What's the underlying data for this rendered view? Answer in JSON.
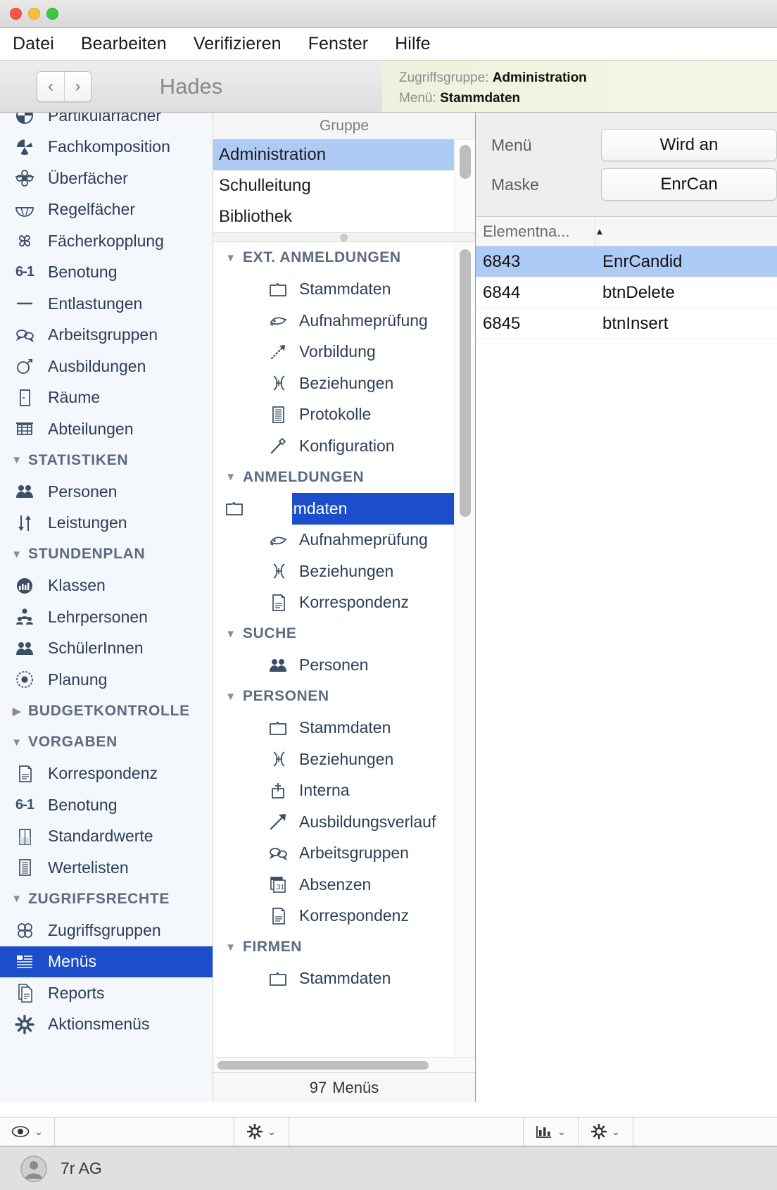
{
  "window": {
    "traffic_lights": [
      "close",
      "minimize",
      "zoom"
    ],
    "app_title": "Hades"
  },
  "menubar": {
    "items": [
      {
        "label": "Datei"
      },
      {
        "label": "Bearbeiten"
      },
      {
        "label": "Verifizieren"
      },
      {
        "label": "Fenster"
      },
      {
        "label": "Hilfe"
      }
    ]
  },
  "toolbar": {
    "back_icon": "‹",
    "forward_icon": "›",
    "title": "Hades",
    "info": {
      "line1_label": "Zugriffsgruppe:",
      "line1_value": "Administration",
      "line2_label": "Menü:",
      "line2_value": "Stammdaten"
    }
  },
  "sidebar": {
    "items": [
      {
        "label": "Partikularfächer",
        "icon": "pie-half-icon",
        "type": "item",
        "clipped": true
      },
      {
        "label": "Fachkomposition",
        "icon": "pie-icon",
        "type": "item"
      },
      {
        "label": "Überfächer",
        "icon": "flower-icon",
        "type": "item"
      },
      {
        "label": "Regelfächer",
        "icon": "halfcircle-icon",
        "type": "item"
      },
      {
        "label": "Fächerkopplung",
        "icon": "pinwheel-icon",
        "type": "item"
      },
      {
        "label": "Benotung",
        "icon": "grade-6-1-icon",
        "type": "item"
      },
      {
        "label": "Entlastungen",
        "icon": "dash-icon",
        "type": "item"
      },
      {
        "label": "Arbeitsgruppen",
        "icon": "speech-bubbles-icon",
        "type": "item"
      },
      {
        "label": "Ausbildungen",
        "icon": "circle-arrow-icon",
        "type": "item"
      },
      {
        "label": "Räume",
        "icon": "door-icon",
        "type": "item"
      },
      {
        "label": "Abteilungen",
        "icon": "building-icon",
        "type": "item"
      },
      {
        "label": "STATISTIKEN",
        "icon": "triangle-down-icon",
        "type": "group",
        "expanded": true
      },
      {
        "label": "Personen",
        "icon": "people-icon",
        "type": "item"
      },
      {
        "label": "Leistungen",
        "icon": "updown-arrows-icon",
        "type": "item"
      },
      {
        "label": "STUNDENPLAN",
        "icon": "triangle-down-icon",
        "type": "group",
        "expanded": true
      },
      {
        "label": "Klassen",
        "icon": "class-circle-icon",
        "type": "item"
      },
      {
        "label": "Lehrpersonen",
        "icon": "teacher-icon",
        "type": "item"
      },
      {
        "label": "SchülerInnen",
        "icon": "people-icon",
        "type": "item"
      },
      {
        "label": "Planung",
        "icon": "target-icon",
        "type": "item"
      },
      {
        "label": "BUDGETKONTROLLE",
        "icon": "triangle-right-icon",
        "type": "group",
        "expanded": false
      },
      {
        "label": "VORGABEN",
        "icon": "triangle-down-icon",
        "type": "group",
        "expanded": true
      },
      {
        "label": "Korrespondenz",
        "icon": "document-icon",
        "type": "item"
      },
      {
        "label": "Benotung",
        "icon": "grade-6-1-icon",
        "type": "item"
      },
      {
        "label": "Standardwerte",
        "icon": "halffilled-doc-icon",
        "type": "item"
      },
      {
        "label": "Wertelisten",
        "icon": "list-lines-icon",
        "type": "item"
      },
      {
        "label": "ZUGRIFFSRECHTE",
        "icon": "triangle-down-icon",
        "type": "group",
        "expanded": true
      },
      {
        "label": "Zugriffsgruppen",
        "icon": "four-circles-icon",
        "type": "item"
      },
      {
        "label": "Menüs",
        "icon": "menu-list-icon",
        "type": "item",
        "selected": true
      },
      {
        "label": "Reports",
        "icon": "report-doc-icon",
        "type": "item"
      },
      {
        "label": "Aktionsmenüs",
        "icon": "gear-icon",
        "type": "item"
      }
    ],
    "selected": "Menüs"
  },
  "middle": {
    "group_column_header": "Gruppe",
    "groups": [
      {
        "label": "Administration",
        "selected": true
      },
      {
        "label": "Schulleitung",
        "selected": false
      },
      {
        "label": "Bibliothek",
        "selected": false
      }
    ],
    "tree": [
      {
        "label": "EXT. ANMELDUNGEN",
        "type": "group",
        "icon": "triangle-down-icon"
      },
      {
        "label": "Stammdaten",
        "type": "item",
        "icon": "folder-icon"
      },
      {
        "label": "Aufnahmeprüfung",
        "type": "item",
        "icon": "exam-icon"
      },
      {
        "label": "Vorbildung",
        "type": "item",
        "icon": "dotted-arrow-icon"
      },
      {
        "label": "Beziehungen",
        "type": "item",
        "icon": "relations-icon"
      },
      {
        "label": "Protokolle",
        "type": "item",
        "icon": "list-lines-icon"
      },
      {
        "label": "Konfiguration",
        "type": "item",
        "icon": "screwdriver-icon"
      },
      {
        "label": "ANMELDUNGEN",
        "type": "group",
        "icon": "triangle-down-icon"
      },
      {
        "label": "Stammdaten",
        "type": "item",
        "icon": "folder-icon",
        "selected": true
      },
      {
        "label": "Aufnahmeprüfung",
        "type": "item",
        "icon": "exam-icon"
      },
      {
        "label": "Beziehungen",
        "type": "item",
        "icon": "relations-icon"
      },
      {
        "label": "Korrespondenz",
        "type": "item",
        "icon": "document-icon"
      },
      {
        "label": "SUCHE",
        "type": "group",
        "icon": "triangle-down-icon"
      },
      {
        "label": "Personen",
        "type": "item",
        "icon": "people-icon"
      },
      {
        "label": "PERSONEN",
        "type": "group",
        "icon": "triangle-down-icon"
      },
      {
        "label": "Stammdaten",
        "type": "item",
        "icon": "folder-icon"
      },
      {
        "label": "Beziehungen",
        "type": "item",
        "icon": "relations-icon"
      },
      {
        "label": "Interna",
        "type": "item",
        "icon": "interna-icon"
      },
      {
        "label": "Ausbildungsverlauf",
        "type": "item",
        "icon": "arrow-up-right-icon"
      },
      {
        "label": "Arbeitsgruppen",
        "type": "item",
        "icon": "speech-bubbles-icon"
      },
      {
        "label": "Absenzen",
        "type": "item",
        "icon": "calendar-icon"
      },
      {
        "label": "Korrespondenz",
        "type": "item",
        "icon": "document-icon"
      },
      {
        "label": "FIRMEN",
        "type": "group",
        "icon": "triangle-down-icon"
      },
      {
        "label": "Stammdaten",
        "type": "item",
        "icon": "folder-icon"
      }
    ],
    "count_number": "97",
    "count_label": "Menüs"
  },
  "right": {
    "form": [
      {
        "label": "Menü",
        "value": "Wird an"
      },
      {
        "label": "Maske",
        "value": "EnrCan"
      }
    ],
    "table": {
      "columns": [
        {
          "label": "Elementna...",
          "sort": "asc"
        },
        {
          "label": ""
        }
      ],
      "rows": [
        {
          "id": "6843",
          "name": "EnrCandid",
          "selected": true
        },
        {
          "id": "6844",
          "name": "btnDelete",
          "selected": false
        },
        {
          "id": "6845",
          "name": "btnInsert",
          "selected": false
        }
      ]
    }
  },
  "bottombar": {
    "tools": [
      {
        "icon": "eye-icon",
        "chev": "⌄"
      },
      {
        "icon": "gear-icon",
        "chev": "⌄"
      },
      {
        "icon": "chart-icon",
        "chev": "⌄"
      },
      {
        "icon": "gear-icon",
        "chev": "⌄"
      }
    ]
  },
  "statusbar": {
    "avatar_icon": "user-avatar-icon",
    "user": "7r AG"
  },
  "colors": {
    "selection_blue": "#1c4ecb",
    "row_highlight": "#aecbf5",
    "info_bg": "#eff0dd",
    "sidebar_bg": "#f4f7fc",
    "text_dark": "#2c3e56"
  }
}
